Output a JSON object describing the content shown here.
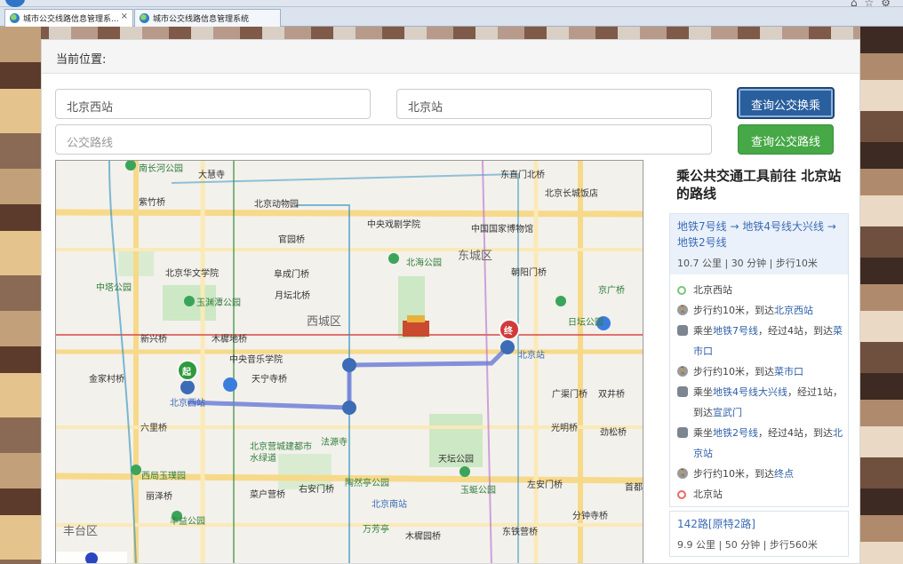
{
  "browser": {
    "tabs": [
      {
        "title": "城市公交线路信息管理系...",
        "active": true
      },
      {
        "title": "城市公交线路信息管理系统",
        "active": false
      }
    ]
  },
  "breadcrumb": {
    "label": "当前位置:"
  },
  "search": {
    "from_value": "北京西站",
    "to_value": "北京站",
    "route_placeholder": "公交路线",
    "transfer_button": "查询公交换乘",
    "route_button": "查询公交路线"
  },
  "map": {
    "labels": {
      "nanchang": "南长河公园",
      "dahuisi": "大慧寺",
      "zizhuyuan": "紫竹桥",
      "dongwuyuan": "北京动物园",
      "dongzhimen": "东直门北桥",
      "changcheng": "北京长城饭店",
      "zhongyang": "中央戏剧学院",
      "guojia": "中国国家博物馆",
      "guanyuan": "官园桥",
      "beihai": "北海公园",
      "dongcheng": "东城区",
      "chaoyangmen": "朝阳门桥",
      "huawen": "北京华文学院",
      "fuchengmen": "阜成门桥",
      "zhongta": "中塔公园",
      "yuyuantan": "玉渊潭公园",
      "yuetan": "月坛北桥",
      "xicheng": "西城区",
      "jingguang": "京广桥",
      "ritan": "日坛公园",
      "xinxing": "新兴桥",
      "muxidi": "木樨地桥",
      "yinyue": "中央音乐学院",
      "jinjiacun": "金家村桥",
      "tianning": "天宁寺桥",
      "beijingzhan": "北京站",
      "guangqumen": "广渠门桥",
      "shuangjing": "双井桥",
      "beijingxi": "北京西站",
      "liuli": "六里桥",
      "guangming": "光明桥",
      "jinsong": "劲松桥",
      "jiangong": "北京营城建都市水绿道",
      "fayuan": "法源寺",
      "tiantan": "天坛公园",
      "zuoanmen": "左安门桥",
      "xiyuquan": "西局玉璞园",
      "taoranting": "陶然亭公园",
      "yuting": "玉蜓公园",
      "lize": "丽泽桥",
      "caihu": "菜户营桥",
      "youanmen": "右安门桥",
      "beijingnan": "北京南站",
      "fengyi": "丰益公园",
      "fengtai": "丰台区",
      "wanfangting": "万芳亭",
      "muxiyuan": "木樨园桥",
      "dongtie": "东铁营桥",
      "fenzhong": "分钟寺桥",
      "shoudu": "首都",
      "tiantanpark": "天坛公园",
      "qi": "起",
      "zhong": "终"
    }
  },
  "route_panel": {
    "title": "乘公共交通工具前往 北京站 的路线",
    "plan1": {
      "lines": "地铁7号线 → 地铁4号线大兴线 → 地铁2号线",
      "meta": "10.7 公里 | 30 分钟 | 步行10米",
      "steps": {
        "s1": "北京西站",
        "s2a": "步行约10米，到达",
        "s2b": "北京西站",
        "s3a": "乘坐",
        "s3b": "地铁7号线",
        "s3c": "，经过4站，到达",
        "s3d": "菜市口",
        "s4a": "步行约10米，到达",
        "s4b": "菜市口",
        "s5a": "乘坐",
        "s5b": "地铁4号线大兴线",
        "s5c": "，经过1站，到达",
        "s5d": "宣武门",
        "s6a": "乘坐",
        "s6b": "地铁2号线",
        "s6c": "，经过4站，到达",
        "s6d": "北京站",
        "s7a": "步行约10米，到达",
        "s7b": "终点",
        "s8": "北京站"
      }
    },
    "plan2": {
      "lines": "142路[原特2路]",
      "meta": "9.9 公里 | 50 分钟 | 步行560米"
    }
  },
  "colors": {
    "primary": "#2a5f9e",
    "success": "#46a846",
    "link": "#3b6cb5"
  }
}
